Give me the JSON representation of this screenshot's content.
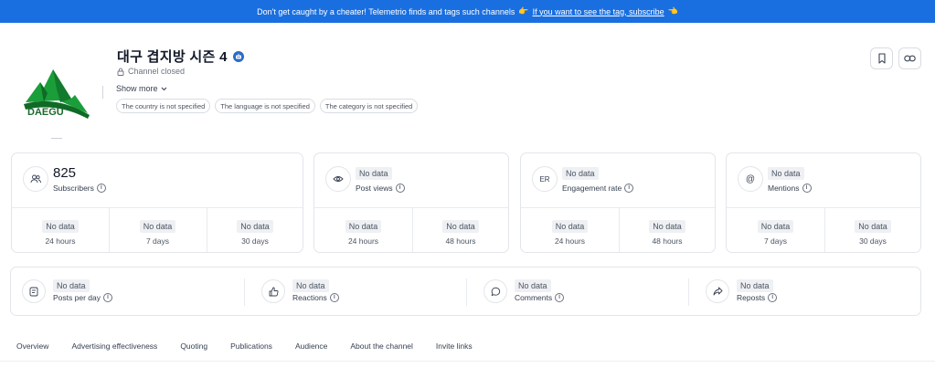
{
  "banner": {
    "text": "Don't get caught by a cheater! Telemetrio finds and tags such channels",
    "link": "If you want to see the tag, subscribe",
    "emoji_a": "👉",
    "emoji_b": "👈"
  },
  "logo": {
    "text": "DAEGU",
    "color": "#1a9e3a"
  },
  "channel": {
    "title": "대구 겹지방 시즌 4",
    "status": "Channel closed",
    "show_more": "Show more",
    "tags": [
      "The country is not specified",
      "The language is not specified",
      "The category is not specified"
    ]
  },
  "metrics": {
    "subscribers": {
      "icon": "users-icon",
      "value": "825",
      "label": "Subscribers",
      "subs": [
        {
          "value": "No data",
          "period": "24 hours"
        },
        {
          "value": "No data",
          "period": "7 days"
        },
        {
          "value": "No data",
          "period": "30 days"
        }
      ]
    },
    "post_views": {
      "icon": "eye-icon",
      "value": "No data",
      "label": "Post views",
      "subs": [
        {
          "value": "No data",
          "period": "24 hours"
        },
        {
          "value": "No data",
          "period": "48 hours"
        }
      ]
    },
    "engagement": {
      "icon_text": "ER",
      "value": "No data",
      "label": "Engagement rate",
      "subs": [
        {
          "value": "No data",
          "period": "24 hours"
        },
        {
          "value": "No data",
          "period": "48 hours"
        }
      ]
    },
    "mentions": {
      "icon_text": "@",
      "value": "No data",
      "label": "Mentions",
      "subs": [
        {
          "value": "No data",
          "period": "7 days"
        },
        {
          "value": "No data",
          "period": "30 days"
        }
      ]
    }
  },
  "row2": [
    {
      "value": "No data",
      "label": "Posts per day",
      "icon": "document-icon"
    },
    {
      "value": "No data",
      "label": "Reactions",
      "icon": "thumbs-up-icon"
    },
    {
      "value": "No data",
      "label": "Comments",
      "icon": "comment-icon"
    },
    {
      "value": "No data",
      "label": "Reposts",
      "icon": "share-icon"
    }
  ],
  "tabs": [
    "Overview",
    "Advertising effectiveness",
    "Quoting",
    "Publications",
    "Audience",
    "About the channel",
    "Invite links"
  ],
  "info_glyph": "i"
}
